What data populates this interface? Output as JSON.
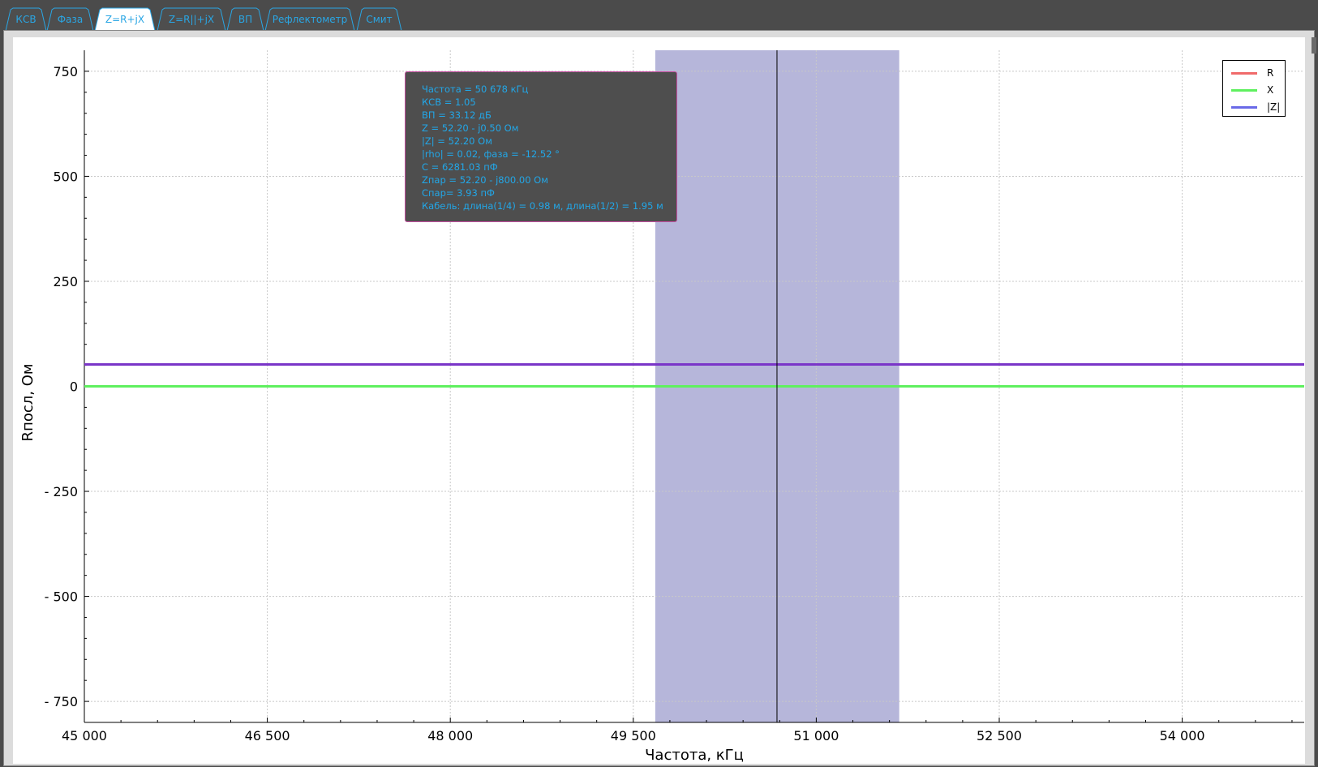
{
  "tabs": [
    {
      "label": "КСВ",
      "active": false
    },
    {
      "label": "Фаза",
      "active": false
    },
    {
      "label": "Z=R+jX",
      "active": true
    },
    {
      "label": "Z=R||+jX",
      "active": false
    },
    {
      "label": "ВП",
      "active": false
    },
    {
      "label": "Рефлектометр",
      "active": false
    },
    {
      "label": "Смит",
      "active": false
    }
  ],
  "tooltip": {
    "lines": [
      "Частота = 50 678 кГц",
      "КСВ = 1.05",
      "ВП = 33.12 дБ",
      "Z = 52.20 - j0.50 Ом",
      "|Z| = 52.20 Ом",
      "|rho| = 0.02, фаза = -12.52 °",
      "C = 6281.03 пФ",
      "Zпар = 52.20 - j800.00 Ом",
      "Cпар= 3.93 пФ",
      "Кабель: длина(1/4) = 0.98 м, длина(1/2) = 1.95 м"
    ]
  },
  "legend": [
    {
      "label": "R",
      "color": "#f06a6a"
    },
    {
      "label": "X",
      "color": "#5ff05f"
    },
    {
      "label": "|Z|",
      "color": "#6a6ae8"
    }
  ],
  "colors": {
    "tab_text": "#2aa6e4",
    "tooltip_text": "#22a7e8",
    "band": "#b6b6da",
    "grid": "#c8c8c8"
  },
  "chart_data": {
    "type": "line",
    "xlabel": "Частота, кГц",
    "ylabel": "Rпосл, Ом",
    "xlim": [
      45000,
      55000
    ],
    "ylim": [
      -800,
      800
    ],
    "x_ticks": [
      45000,
      46500,
      48000,
      49500,
      51000,
      52500,
      54000
    ],
    "x_tick_labels": [
      "45 000",
      "46 500",
      "48 000",
      "49 500",
      "51 000",
      "52 500",
      "54 000"
    ],
    "y_ticks": [
      750,
      500,
      250,
      0,
      -250,
      -500,
      -750
    ],
    "y_tick_labels": [
      "750",
      "500",
      "250",
      "0",
      "- 250",
      "- 500",
      "- 750"
    ],
    "grid": true,
    "legend_position": "top-right",
    "highlight_band": [
      49680,
      51680
    ],
    "cursor_x": 50678,
    "series": [
      {
        "name": "R",
        "color": "#f06a6a",
        "x": [
          45000,
          55000
        ],
        "y": [
          52.2,
          52.2
        ]
      },
      {
        "name": "X",
        "color": "#5ff05f",
        "x": [
          45000,
          55000
        ],
        "y": [
          0,
          0
        ]
      },
      {
        "name": "|Z|",
        "color": "#6a6ae8",
        "x": [
          45000,
          55000
        ],
        "y": [
          52.2,
          52.2
        ]
      }
    ]
  }
}
